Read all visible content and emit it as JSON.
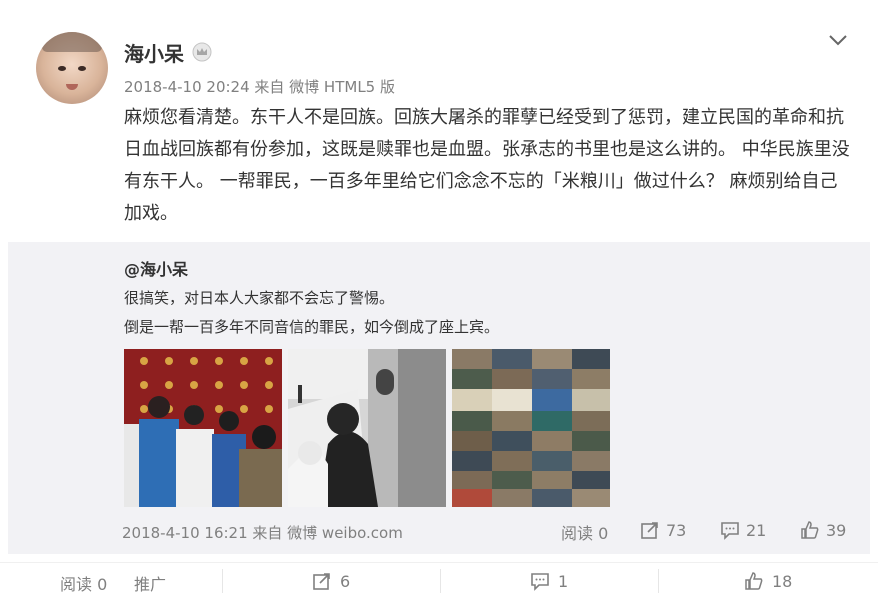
{
  "post": {
    "author": "海小呆",
    "meta": "2018-4-10 20:24 来自 微博 HTML5 版",
    "text": "麻烦您看清楚。东干人不是回族。回族大屠杀的罪孽已经受到了惩罚，建立民国的革命和抗日血战回族都有份参加，这既是赎罪也是血盟。张承志的书里也是这么讲的。 中华民族里没有东干人。 一帮罪民，一百多年里给它们念念不忘的「米粮川」做过什么？ 麻烦别给自己加戏。"
  },
  "repost": {
    "author": "@海小呆",
    "line1": "很搞笑，对日本人大家都不会忘了警惕。",
    "line2": "倒是一帮一百多年不同音信的罪民，如今倒成了座上宾。",
    "meta": "2018-4-10 16:21 来自 微博 weibo.com",
    "reads": "阅读 0",
    "reposts": "73",
    "comments": "21",
    "likes": "39"
  },
  "bottom_bar": {
    "reads": "阅读 0",
    "promote": "推广",
    "reposts": "6",
    "comments": "1",
    "likes": "18"
  },
  "icons": {
    "vip": "crown-badge-icon",
    "more": "chevron-down-icon",
    "repost": "share-icon",
    "comment": "comment-icon",
    "like": "thumbs-up-icon"
  }
}
